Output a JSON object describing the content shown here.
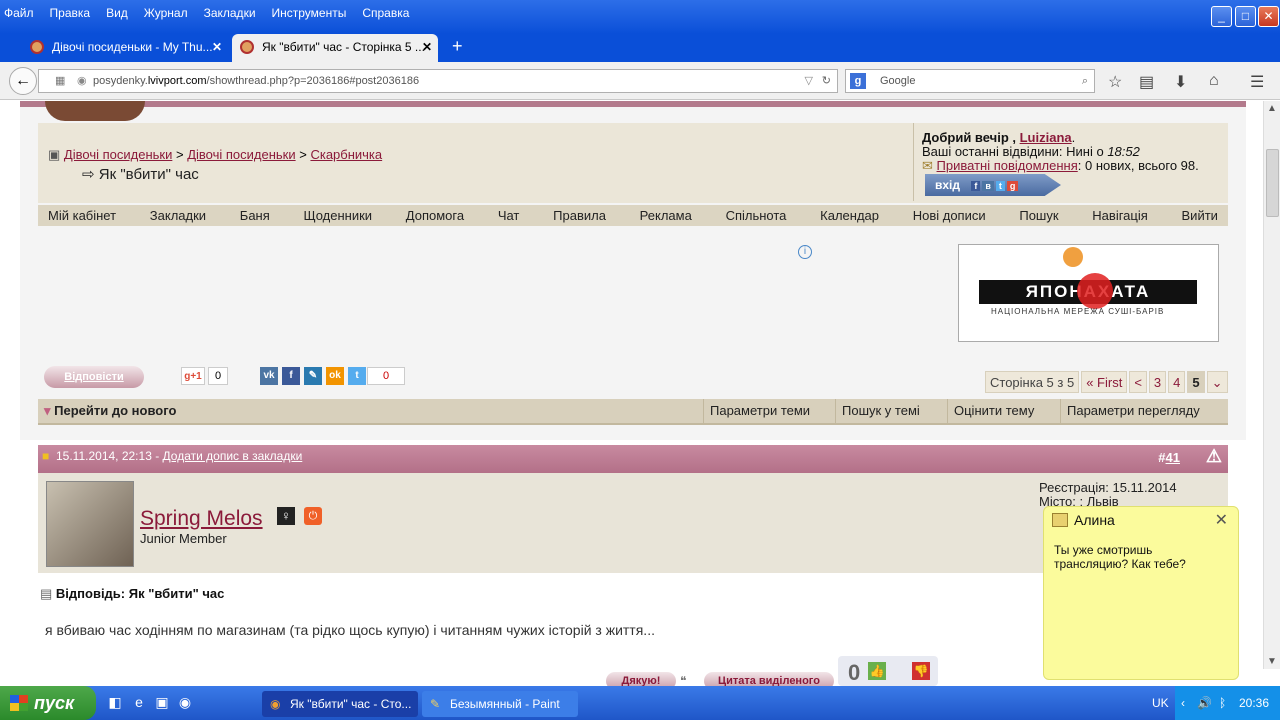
{
  "browser": {
    "menu": [
      "Файл",
      "Правка",
      "Вид",
      "Журнал",
      "Закладки",
      "Инструменты",
      "Справка"
    ],
    "tabs": [
      {
        "title": "Дівочі посиденьки - My Thu..."
      },
      {
        "title": "Як \"вбити\" час - Сторінка 5 ..."
      }
    ],
    "url_prefix": "posydenky.",
    "url_host": "lvivport.com",
    "url_path": "/showthread.php?p=2036186#post2036186",
    "search_placeholder": "Google"
  },
  "forum": {
    "breadcrumb": [
      "Дівочі посиденьки",
      "Дівочі посиденьки",
      "Скарбничка"
    ],
    "crumb_sep": ">",
    "thread_title": "Як \"вбити\" час",
    "greeting": "Добрий вечір ,",
    "greeting_user": "Luiziana",
    "last_visit": "Ваші останні відвідини: Нині о",
    "last_visit_time": "18:52",
    "pm_link": "Приватні повідомлення",
    "pm_stats": ": 0 нових, всього 98.",
    "login_label": "вхід",
    "nav": [
      "Мій кабінет",
      "Закладки",
      "Баня",
      "Щоденники",
      "Допомога",
      "Чат",
      "Правила",
      "Реклама",
      "Спільнота",
      "Календар",
      "Нові дописи",
      "Пошук",
      "Навігація",
      "Вийти"
    ],
    "ad_text": "ЯПОНАХАТА",
    "ad_sub": "НАЦІОНАЛЬНА МЕРЕЖА   СУШІ-БАРІВ",
    "reply_label": "Відповісти",
    "gplus_label": "g+1",
    "gplus_count": "0",
    "share_count": "0",
    "pager": {
      "label": "Сторінка 5 з 5",
      "first": "« First",
      "prev": "<",
      "pages": [
        "3",
        "4"
      ],
      "current": "5"
    },
    "threadbar": {
      "goto_new": "Перейти до нового",
      "params": "Параметри теми",
      "search": "Пошук у темі",
      "rate": "Оцінити тему",
      "view": "Параметри перегляду"
    }
  },
  "post": {
    "date": "15.11.2014, 22:13 -",
    "bookmark_link": "Додати допис в закладки",
    "number_prefix": "#",
    "number": "41",
    "username": "Spring Melos",
    "usertitle": "Junior Member",
    "registered": "Реєстрація: 15.11.2014",
    "city": "Місто: : Львів",
    "title": "Відповідь: Як \"вбити\" час",
    "text": "я вбиваю час ходінням по магазинам (та рідко щось купую) і читанням чужих історій з життя...",
    "thanks_label": "Дякую!",
    "quote_label": "Цитата виділеного",
    "likes": "0"
  },
  "popup": {
    "name": "Алина",
    "message": "Ты уже смотришь трансляцию? Как тебе?"
  },
  "taskbar": {
    "start": "пуск",
    "items": [
      "Як \"вбити\" час - Сто...",
      "Безымянный - Paint"
    ],
    "lang": "UK",
    "time": "20:36"
  }
}
